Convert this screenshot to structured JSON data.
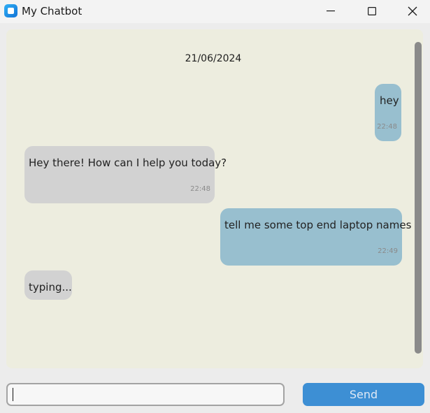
{
  "window": {
    "title": "My Chatbot",
    "controls": [
      "minimize-icon",
      "maximize-icon",
      "close-icon"
    ]
  },
  "chat": {
    "date": "21/06/2024",
    "messages": [
      {
        "sender": "user",
        "text": "hey",
        "time": "22:48"
      },
      {
        "sender": "bot",
        "text": "Hey there! How can I help you today?",
        "time": "22:48"
      },
      {
        "sender": "user",
        "text": "tell me some top end laptop names",
        "time": "22:49"
      },
      {
        "sender": "bot",
        "text": "typing...",
        "time": ""
      }
    ]
  },
  "input": {
    "value": "",
    "placeholder": ""
  },
  "send_button": {
    "label": "Send"
  },
  "colors": {
    "chat_background": "#ededdf",
    "user_bubble": "#98bfcf",
    "bot_bubble": "#d2d2d2",
    "send_button": "#3d8fd4"
  }
}
